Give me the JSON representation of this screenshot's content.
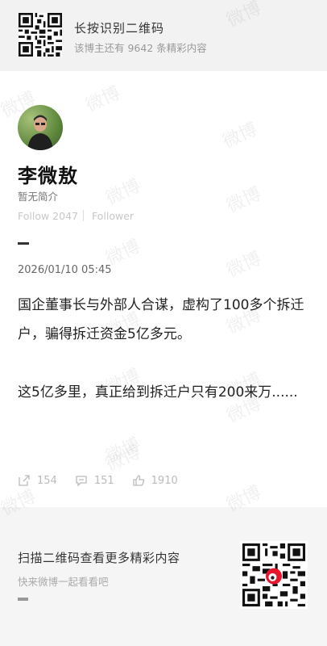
{
  "banner": {
    "title": "长按识别二维码",
    "subtitle": "该博主还有 9642 条精彩内容"
  },
  "profile": {
    "name": "李微敖",
    "bio": "暂无简介",
    "follow": "Follow 2047",
    "follower": "Follower"
  },
  "post": {
    "marker": "-",
    "date": "2026/01/10 05:45",
    "text": "国企董事长与外部人合谋，虚构了100多个拆迁户，骗得拆迁资金5亿多元。\n\n这5亿多里，真正给到拆迁户只有200来万......"
  },
  "actions": {
    "share_count": "154",
    "comment_count": "151",
    "like_count": "1910"
  },
  "footer": {
    "title": "扫描二维码查看更多精彩内容",
    "subtitle": "快来微博一起看看吧"
  },
  "watermark": "微博",
  "colors": {
    "background": "#f5f5f5",
    "card": "#ffffff",
    "muted": "#c7c7c7",
    "text": "#222222"
  }
}
